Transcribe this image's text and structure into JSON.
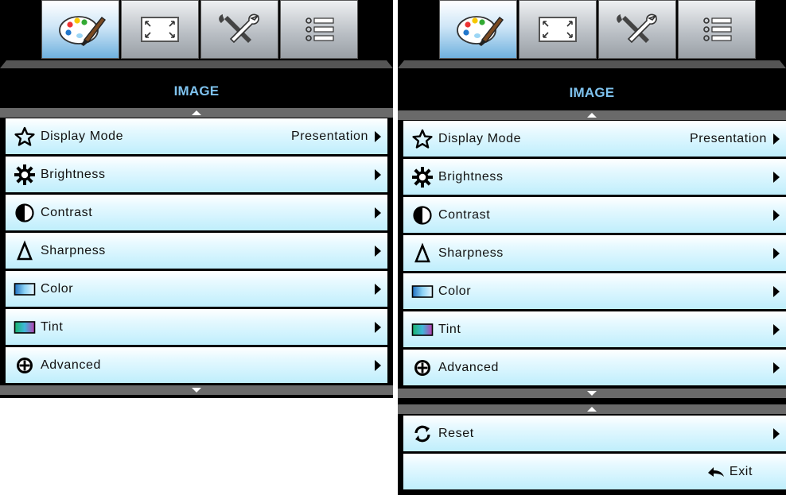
{
  "tabs": [
    {
      "icon": "palette-icon",
      "active": true
    },
    {
      "icon": "display-resize-icon",
      "active": false
    },
    {
      "icon": "settings-tools-icon",
      "active": false
    },
    {
      "icon": "options-list-icon",
      "active": false
    }
  ],
  "panel_left": {
    "title": "IMAGE",
    "items": [
      {
        "label": "Display Mode",
        "value": "Presentation",
        "icon": "star-icon"
      },
      {
        "label": "Brightness",
        "value": "",
        "icon": "brightness-icon"
      },
      {
        "label": "Contrast",
        "value": "",
        "icon": "contrast-icon"
      },
      {
        "label": "Sharpness",
        "value": "",
        "icon": "sharpness-icon"
      },
      {
        "label": "Color",
        "value": "",
        "icon": "color-icon"
      },
      {
        "label": "Tint",
        "value": "",
        "icon": "tint-icon"
      },
      {
        "label": "Advanced",
        "value": "",
        "icon": "advanced-icon"
      }
    ]
  },
  "panel_right": {
    "title": "IMAGE",
    "items": [
      {
        "label": "Display Mode",
        "value": "Presentation",
        "icon": "star-icon"
      },
      {
        "label": "Brightness",
        "value": "",
        "icon": "brightness-icon"
      },
      {
        "label": "Contrast",
        "value": "",
        "icon": "contrast-icon"
      },
      {
        "label": "Sharpness",
        "value": "",
        "icon": "sharpness-icon"
      },
      {
        "label": "Color",
        "value": "",
        "icon": "color-icon"
      },
      {
        "label": "Tint",
        "value": "",
        "icon": "tint-icon"
      },
      {
        "label": "Advanced",
        "value": "",
        "icon": "advanced-icon"
      }
    ],
    "page2_items": [
      {
        "label": "Reset",
        "icon": "reset-icon"
      }
    ],
    "exit_label": "Exit"
  },
  "colors": {
    "title": "#7fc3ef",
    "row_top": "#ffffff",
    "row_bottom": "#bfeefc",
    "active_tab": "#6fb1de"
  }
}
